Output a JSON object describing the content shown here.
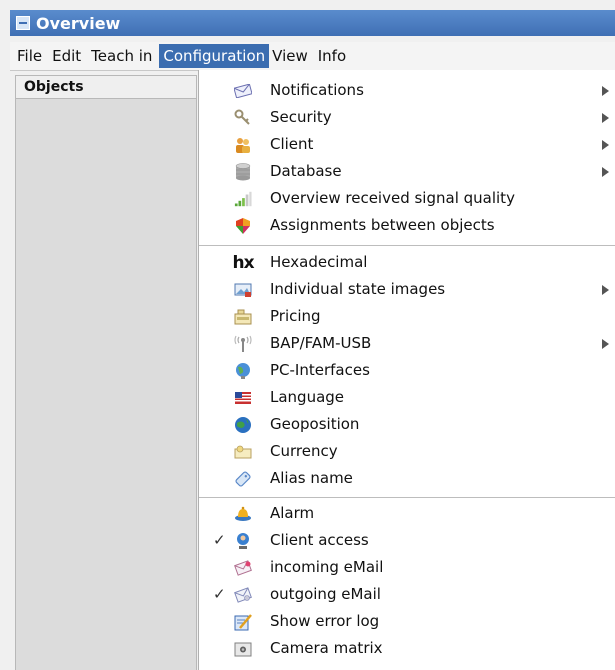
{
  "window": {
    "title": "Overview"
  },
  "menubar": {
    "items": [
      {
        "label": "File"
      },
      {
        "label": "Edit"
      },
      {
        "label": "Teach in"
      },
      {
        "label": "Configuration"
      },
      {
        "label": "View"
      },
      {
        "label": "Info"
      }
    ]
  },
  "objects_panel": {
    "header": "Objects"
  },
  "configuration_menu": {
    "group1": [
      {
        "label": "Notifications",
        "icon": "envelope-icon",
        "submenu": true
      },
      {
        "label": "Security",
        "icon": "keys-icon",
        "submenu": true
      },
      {
        "label": "Client",
        "icon": "users-icon",
        "submenu": true
      },
      {
        "label": "Database",
        "icon": "database-icon",
        "submenu": true
      },
      {
        "label": "Overview received signal quality",
        "icon": "signal-bars-icon",
        "submenu": false
      },
      {
        "label": "Assignments between objects",
        "icon": "puzzle-icon",
        "submenu": false
      }
    ],
    "group2": [
      {
        "label": "Hexadecimal",
        "icon": "hx-icon",
        "icon_text": "hx",
        "submenu": false
      },
      {
        "label": "Individual state images",
        "icon": "image-icon",
        "submenu": true
      },
      {
        "label": "Pricing",
        "icon": "price-tag-icon",
        "submenu": false
      },
      {
        "label": "BAP/FAM-USB",
        "icon": "antenna-icon",
        "submenu": true
      },
      {
        "label": "PC-Interfaces",
        "icon": "globe-network-icon",
        "submenu": false
      },
      {
        "label": "Language",
        "icon": "flag-icon",
        "submenu": false
      },
      {
        "label": "Geoposition",
        "icon": "globe-icon",
        "submenu": false
      },
      {
        "label": "Currency",
        "icon": "currency-note-icon",
        "submenu": false
      },
      {
        "label": "Alias name",
        "icon": "tag-icon",
        "submenu": false
      }
    ],
    "group3": [
      {
        "label": "Alarm",
        "icon": "alarm-bell-icon",
        "checked": false
      },
      {
        "label": "Client access",
        "icon": "client-access-icon",
        "checked": true
      },
      {
        "label": "incoming eMail",
        "icon": "incoming-mail-icon",
        "checked": false
      },
      {
        "label": "outgoing eMail",
        "icon": "outgoing-mail-icon",
        "checked": true
      },
      {
        "label": "Show error log",
        "icon": "edit-log-icon",
        "checked": false
      },
      {
        "label": "Camera matrix",
        "icon": "camera-icon",
        "checked": false
      }
    ],
    "check_glyph": "✓"
  },
  "colors": {
    "title_bar": "#3f6fb4",
    "menu_highlight": "#3b6db0"
  }
}
